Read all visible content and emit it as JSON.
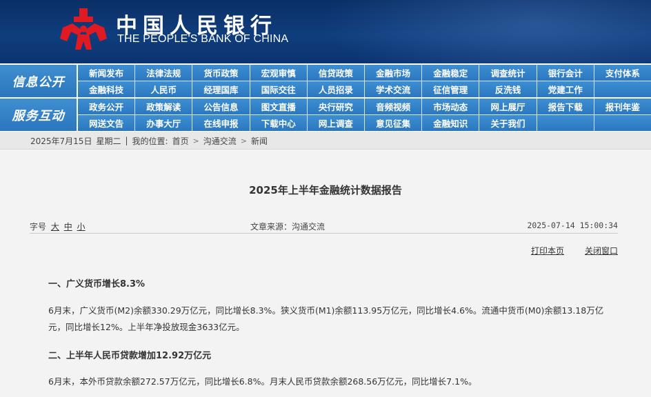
{
  "header": {
    "logo_cn": "中国人民银行",
    "logo_en": "THE PEOPLE'S BANK OF CHINA",
    "logo_icon": "pboc-emblem-icon",
    "colors": {
      "header_bg": "#0f3d7d",
      "logo_red": "#e01a22",
      "nav_blue": "#2b77c0"
    }
  },
  "nav": {
    "group1_label": "信息公开",
    "group1_items": [
      "新闻发布",
      "法律法规",
      "货币政策",
      "宏观审慎",
      "信贷政策",
      "金融市场",
      "金融稳定",
      "调查统计",
      "银行会计",
      "支付体系",
      "金融科技",
      "人民币",
      "经理国库",
      "国际交往",
      "人员招录",
      "学术交流",
      "征信管理",
      "反洗钱",
      "党建工作",
      ""
    ],
    "group2_label": "服务互动",
    "group2_items": [
      "政务公开",
      "政策解读",
      "公告信息",
      "图文直播",
      "央行研究",
      "音频视频",
      "市场动态",
      "网上展厅",
      "报告下载",
      "报刊年鉴",
      "网送文告",
      "办事大厅",
      "在线申报",
      "下载中心",
      "网上调查",
      "意见征集",
      "金融知识",
      "关于我们",
      "",
      ""
    ]
  },
  "breadcrumb": {
    "date": "2025年7月15日",
    "weekday": "星期二",
    "divider": "|",
    "location_label": "我的位置:",
    "home": "首页",
    "level1": "沟通交流",
    "level2": "新闻",
    "sep": ">"
  },
  "article": {
    "title": "2025年上半年金融统计数据报告",
    "font_label": "字号",
    "font_large": "大",
    "font_medium": "中",
    "font_small": "小",
    "source": "文章来源：沟通交流",
    "datetime": "2025-07-14 15:00:34",
    "print_label": "打印本页",
    "close_label": "关闭窗口",
    "section1_title": "一、广义货币增长8.3%",
    "section1_text": "6月末，广义货币(M2)余额330.29万亿元，同比增长8.3%。狭义货币(M1)余额113.95万亿元，同比增长4.6%。流通中货币(M0)余额13.18万亿元，同比增长12%。上半年净投放现金3633亿元。",
    "section2_title": "二、上半年人民币贷款增加12.92万亿元",
    "section2_text": "6月末，本外币贷款余额272.57万亿元，同比增长6.8%。月末人民币贷款余额268.56万亿元，同比增长7.1%。"
  }
}
